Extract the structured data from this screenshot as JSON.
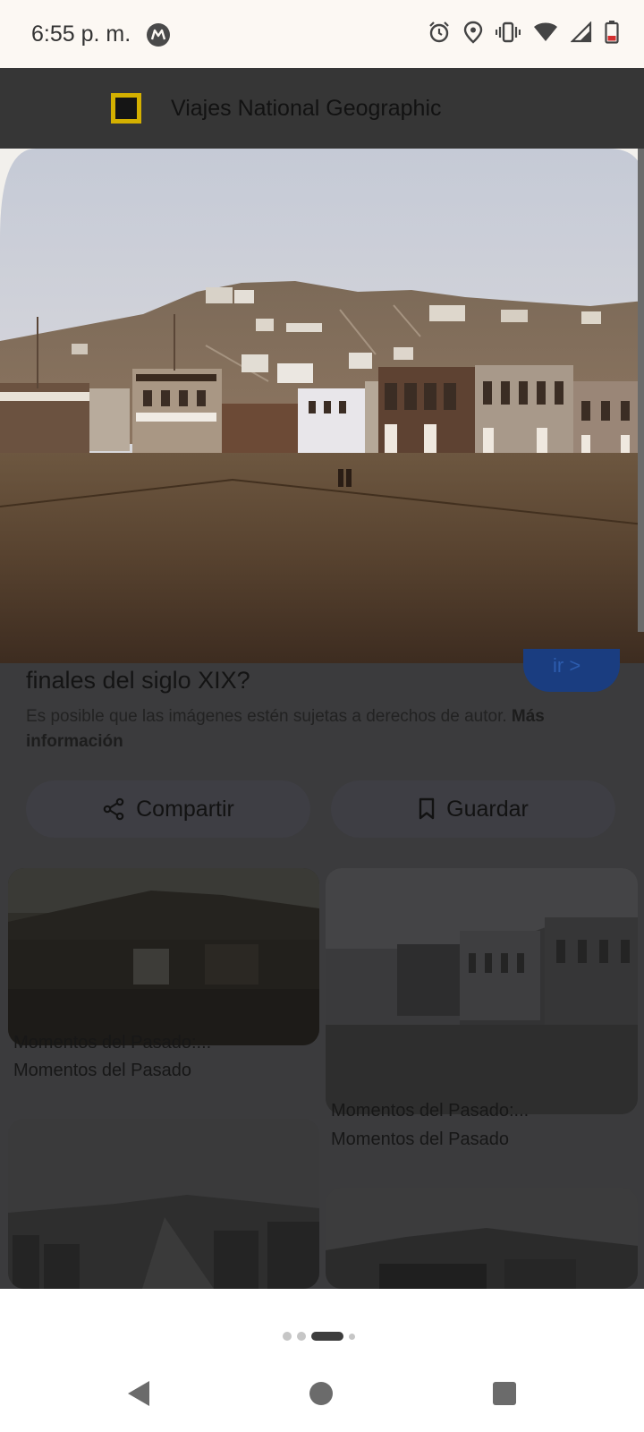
{
  "status_bar": {
    "time": "6:55 p. m.",
    "icons": [
      "motorola-icon",
      "alarm-icon",
      "location-icon",
      "vibrate-icon",
      "wifi-icon",
      "signal-icon",
      "battery-icon"
    ]
  },
  "source": {
    "logo_icon": "nat-geo-logo-icon",
    "name": "Viajes National Geographic"
  },
  "photo": {
    "icon": "sepia-1850s-san-francisco-daguerreotype"
  },
  "detail": {
    "title": "finales del siglo XIX?",
    "visit_label": "ir >",
    "copyright_text": "Es posible que las imágenes estén sujetas a derechos de autor.",
    "copyright_link": "Más información"
  },
  "actions": {
    "share_label": "Compartir",
    "save_label": "Guardar"
  },
  "related": [
    {
      "title": "Momentos del Pasado:...",
      "source": "Momentos del Pasado"
    },
    {
      "title": "Momentos del Pasado:...",
      "source": "Momentos del Pasado"
    },
    {
      "title": "",
      "source": ""
    },
    {
      "title": "",
      "source": ""
    }
  ],
  "pager": {
    "pages": 4,
    "active_index": 2
  },
  "colors": {
    "status_bg": "#fcf8f3",
    "scrim": "#3b3b3d",
    "accent": "#1a3d80",
    "nat_geo_yellow": "#d4b000"
  }
}
